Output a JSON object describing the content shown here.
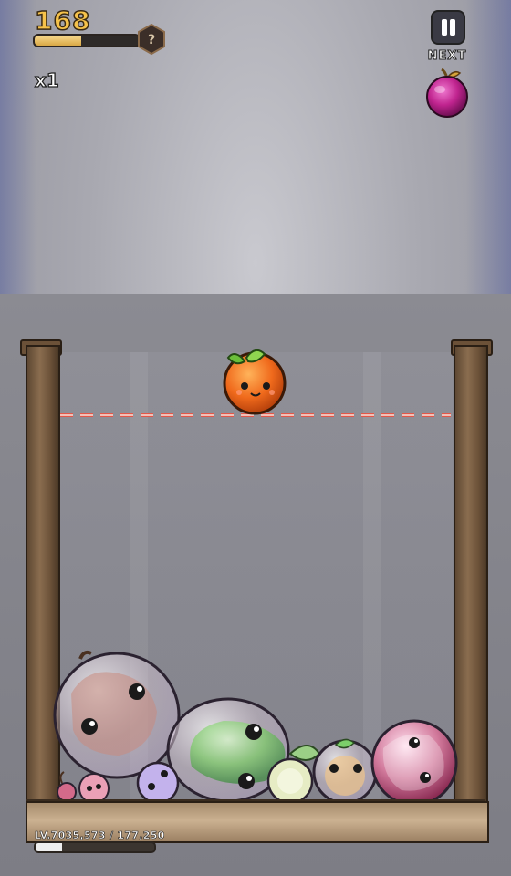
{
  "hud": {
    "score": "168",
    "xp_progress": 0.45,
    "hex_badge": "?",
    "multiplier": "x1",
    "next_label": "NEXT"
  },
  "next_fruit": {
    "kind": "plum",
    "color": "#c0248f"
  },
  "current_fruit": {
    "kind": "orange",
    "color": "#f06a1c"
  },
  "jar": {
    "fruits": [
      {
        "kind": "peach",
        "color": "#e8b9c4"
      },
      {
        "kind": "pear",
        "color": "#7ecb6a"
      },
      {
        "kind": "apple",
        "color": "#c85a7a"
      },
      {
        "kind": "mandarin",
        "color": "#f0d29a"
      },
      {
        "kind": "lime",
        "color": "#dfe6b0"
      },
      {
        "kind": "grape",
        "color": "#b9a6e6"
      },
      {
        "kind": "cherry",
        "color": "#d46a8a"
      },
      {
        "kind": "strawberry",
        "color": "#e98aa6"
      }
    ]
  },
  "level": {
    "text": "LV.7035,573 / 177,250",
    "progress": 0.22
  }
}
